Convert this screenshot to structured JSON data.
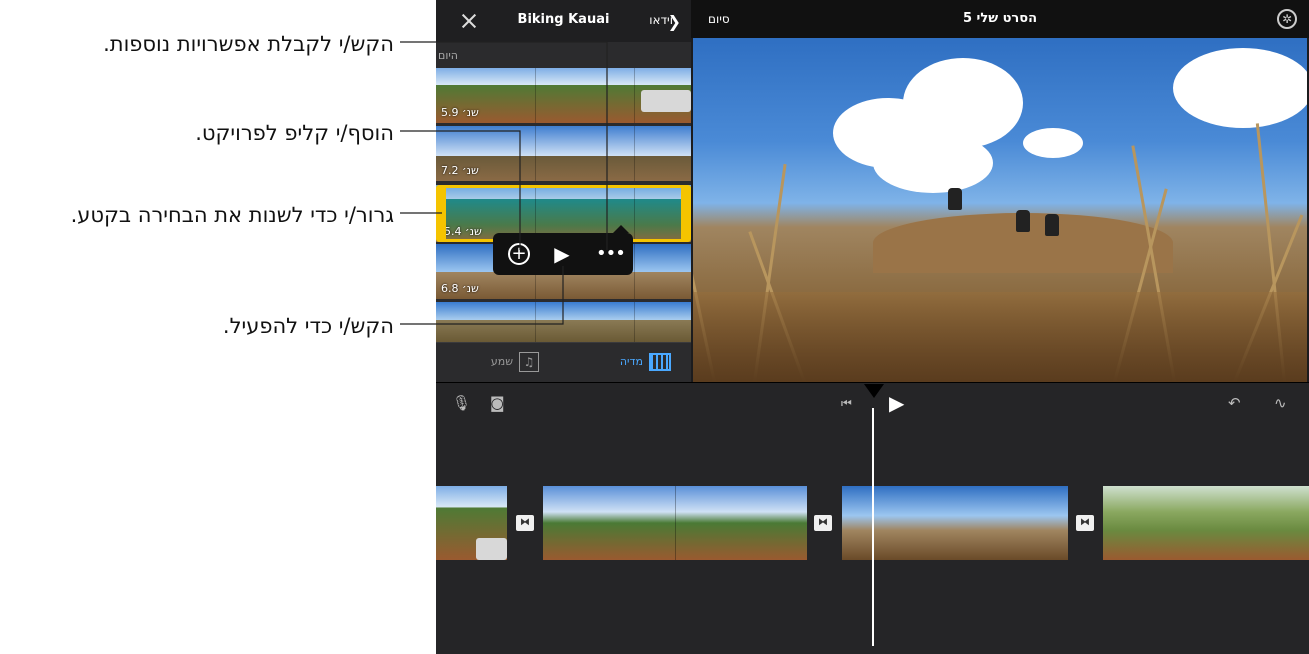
{
  "callouts": {
    "more_options": "הקש/י לקבלת אפשרויות נוספות.",
    "add_clip": "הוסף/י קליפ לפרויקט.",
    "drag_selection": "גרור/י כדי לשנות את הבחירה בקטע.",
    "play": "הקש/י כדי להפעיל."
  },
  "browser": {
    "title": "Biking Kauai",
    "back_label": "וידאו",
    "section": "היום",
    "clips": [
      {
        "duration": "5.9 שנ׳"
      },
      {
        "duration": "7.2 שנ׳"
      },
      {
        "duration": "5.4 שנ׳"
      },
      {
        "duration": "6.8 שנ׳"
      }
    ],
    "tabs": {
      "media": "מדיה",
      "audio": "שמע"
    }
  },
  "popup": {
    "add_icon": "plus-circle-icon",
    "play_icon": "play-icon",
    "more_icon": "more-icon"
  },
  "viewer": {
    "project_title": "הסרט שלי 5",
    "done_label": "סיום"
  },
  "colors": {
    "accent": "#4aa8ff",
    "selection": "#f5c400",
    "background": "#1c1c1e"
  }
}
